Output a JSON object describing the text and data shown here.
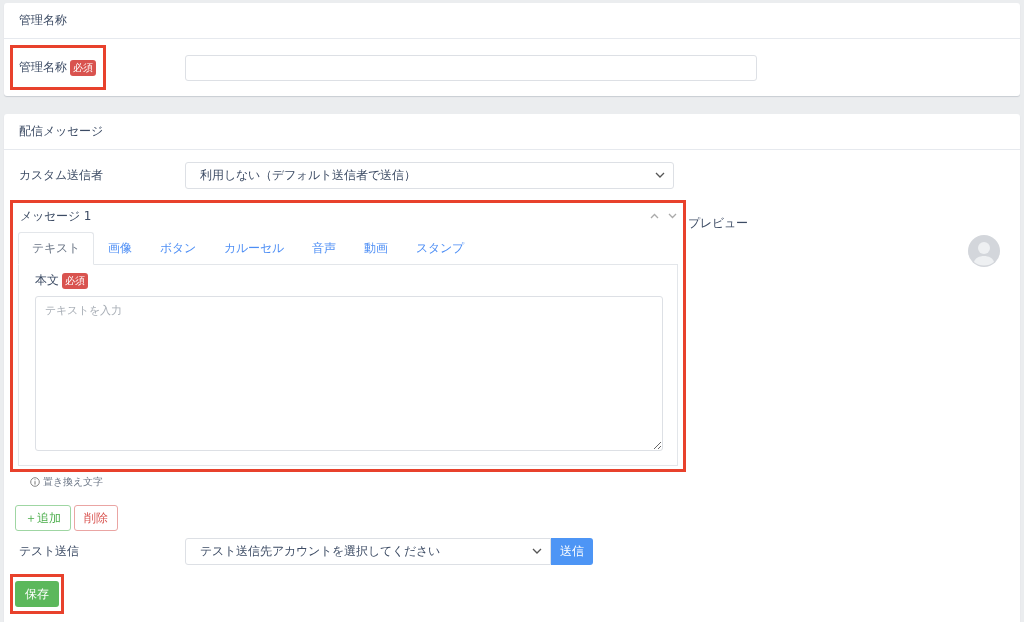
{
  "name_section": {
    "title": "管理名称",
    "label": "管理名称",
    "required_badge": "必須",
    "highlighted": true
  },
  "message_section": {
    "title": "配信メッセージ",
    "sender_label": "カスタム送信者",
    "sender_value": "利用しない（デフォルト送信者で送信）",
    "message": {
      "title": "メッセージ 1",
      "highlighted": true,
      "tabs": [
        {
          "label": "テキスト",
          "selected": true
        },
        {
          "label": "画像",
          "selected": false
        },
        {
          "label": "ボタン",
          "selected": false
        },
        {
          "label": "カルーセル",
          "selected": false
        },
        {
          "label": "音声",
          "selected": false
        },
        {
          "label": "動画",
          "selected": false
        },
        {
          "label": "スタンプ",
          "selected": false
        }
      ],
      "body_label": "本文",
      "required_badge": "必須",
      "placeholder": "テキストを入力"
    },
    "preview_label": "プレビュー",
    "hint": "置き換え文字",
    "add_button": "＋追加",
    "delete_button": "削除",
    "test_label": "テスト送信",
    "test_select": "テスト送信先アカウントを選択してください",
    "send_button": "送信",
    "save_button": {
      "label": "保存",
      "highlighted": true
    }
  }
}
